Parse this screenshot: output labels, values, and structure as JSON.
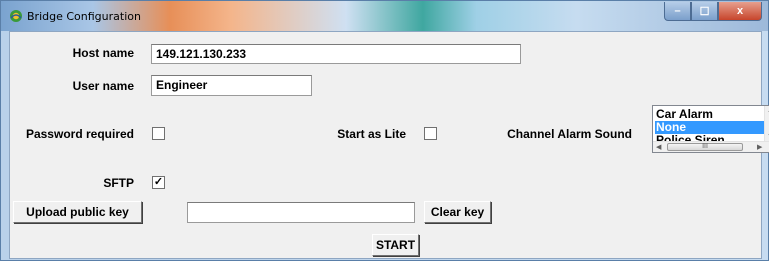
{
  "window": {
    "title": "Bridge Configuration",
    "min_glyph": "–",
    "max_glyph": "☐",
    "close_glyph": "x"
  },
  "form": {
    "host_label": "Host name",
    "host_value": "149.121.130.233",
    "user_label": "User name",
    "user_value": "Engineer",
    "password_label": "Password required",
    "password_checked": false,
    "lite_label": "Start as Lite",
    "lite_checked": false,
    "alarm_label": "Channel Alarm Sound",
    "sftp_label": "SFTP",
    "sftp_checked": true,
    "sftp_mark": "✓",
    "upload_button": "Upload public key",
    "key_value": "",
    "clear_button": "Clear key",
    "start_button": "START"
  },
  "alarm_list": {
    "items": [
      "Car Alarm",
      "None",
      "Police Siren"
    ],
    "selected": "None",
    "hscroll_grip": "III"
  },
  "colors": {
    "selection": "#3399ff",
    "close_button": "#c7452c"
  }
}
